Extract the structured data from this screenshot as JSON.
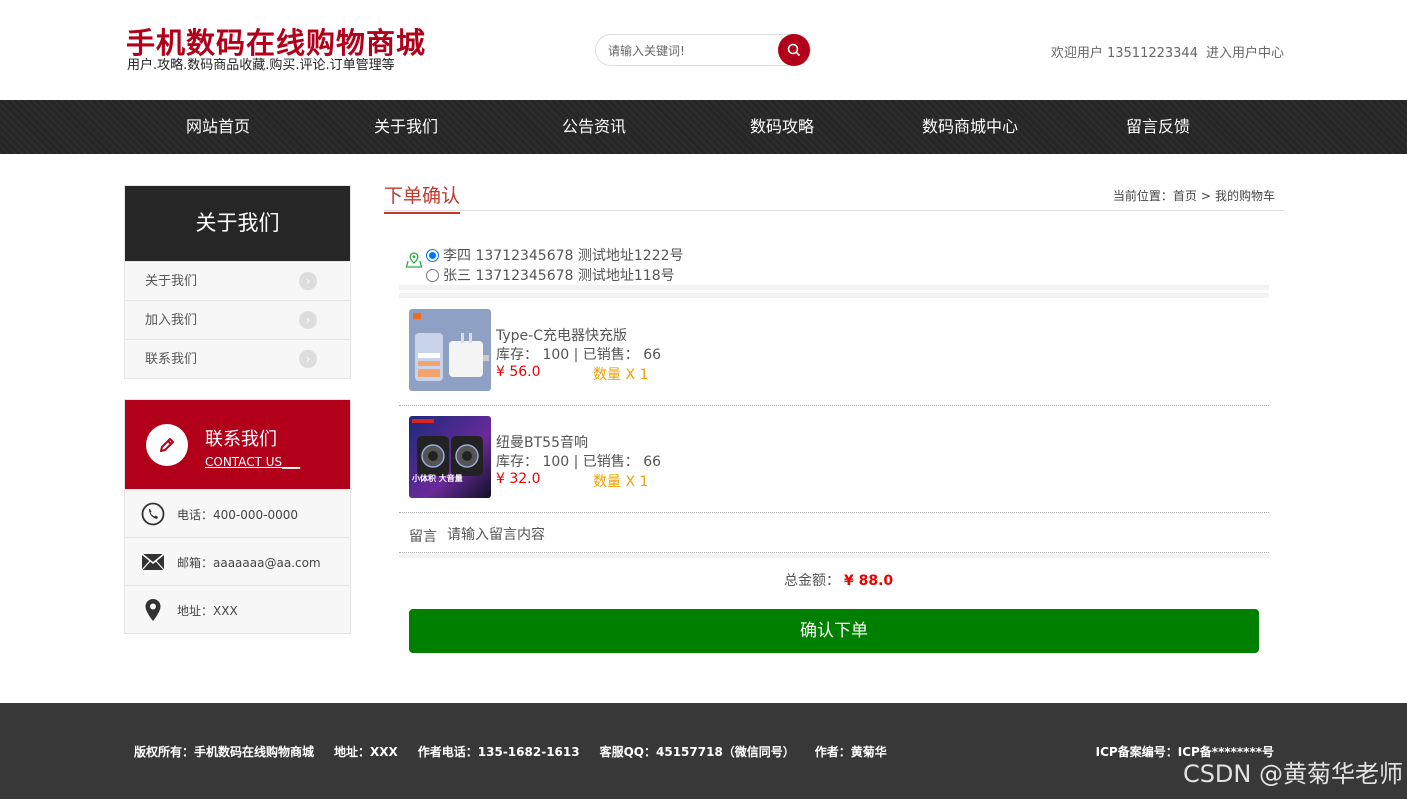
{
  "header": {
    "title": "手机数码在线购物商城",
    "subtitle": "用户.攻略.数码商品收藏.购买.评论.订单管理等",
    "search_placeholder": "请输入关键词!",
    "welcome": "欢迎用户 13511223344",
    "user_center": "进入用户中心"
  },
  "nav": [
    "网站首页",
    "关于我们",
    "公告资讯",
    "数码攻略",
    "数码商城中心",
    "留言反馈"
  ],
  "sidebar": {
    "about_title": "关于我们",
    "about_items": [
      "关于我们",
      "加入我们",
      "联系我们"
    ],
    "contact_title": "联系我们",
    "contact_en": "CONTACT US___",
    "phone": "电话：400-000-0000",
    "email": "邮箱：aaaaaaa@aa.com",
    "address": "地址：XXX"
  },
  "main": {
    "title": "下单确认",
    "breadcrumb_prefix": "当前位置：",
    "breadcrumb_home": "首页",
    "breadcrumb_sep": ">",
    "breadcrumb_current": "我的购物车",
    "addresses": [
      {
        "text": "李四 13712345678 测试地址1222号",
        "selected": true
      },
      {
        "text": "张三 13712345678 测试地址118号",
        "selected": false
      }
    ],
    "products": [
      {
        "name": "Type-C充电器快充版",
        "stock": "库存： 100 | 已销售： 66",
        "price": "¥ 56.0",
        "qty": "数量 X 1"
      },
      {
        "name": "纽曼BT55音响",
        "stock": "库存： 100 | 已销售： 66",
        "price": "¥ 32.0",
        "qty": "数量 X 1"
      }
    ],
    "message_label": "留言",
    "message_placeholder": "请输入留言内容",
    "total_label": "总金额：",
    "total_amount": "¥ 88.0",
    "confirm": "确认下单",
    "product2_banner": "小体积 大音量"
  },
  "footer": {
    "copyright": "版权所有：手机数码在线购物商城",
    "address": "地址：XXX",
    "author_phone": "作者电话：135-1682-1613",
    "qq": "客服QQ：45157718（微信同号）",
    "author": "作者：黄菊华",
    "icp": "ICP备案编号：ICP备********号",
    "watermark": "CSDN @黄菊华老师"
  },
  "colors": {
    "brand": "#b3001a",
    "confirm": "#008000",
    "price": "#ee0000",
    "qty": "#f0a000"
  }
}
